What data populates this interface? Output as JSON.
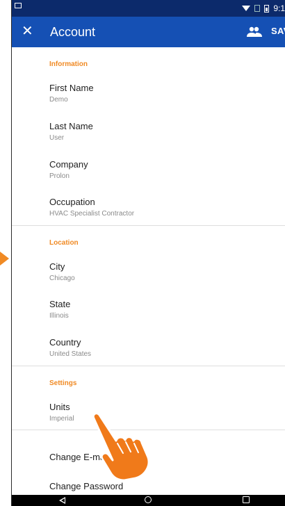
{
  "status_bar": {
    "time": "9:1"
  },
  "app_bar": {
    "close_symbol": "✕",
    "title": "Account",
    "contacts_icon": "people-icon",
    "save_label": "SAV"
  },
  "sections": {
    "information": {
      "header": "Information",
      "items": [
        {
          "title": "First Name",
          "value": "Demo"
        },
        {
          "title": "Last Name",
          "value": "User"
        },
        {
          "title": "Company",
          "value": "Prolon"
        },
        {
          "title": "Occupation",
          "value": "HVAC Specialist Contractor"
        }
      ]
    },
    "location": {
      "header": "Location",
      "items": [
        {
          "title": "City",
          "value": "Chicago"
        },
        {
          "title": "State",
          "value": "Illinois"
        },
        {
          "title": "Country",
          "value": "United States"
        }
      ]
    },
    "settings": {
      "header": "Settings",
      "items": [
        {
          "title": "Units",
          "value": "Imperial"
        }
      ]
    },
    "actions": {
      "items": [
        {
          "title": "Change E-mail"
        },
        {
          "title": "Change Password"
        }
      ]
    }
  },
  "colors": {
    "status_bar": "#0c2a6b",
    "app_bar": "#1550b4",
    "section_header": "#f08a24",
    "pointer": "#f08a24"
  },
  "overlay": {
    "pointer_icon": "tap-hand-icon"
  }
}
